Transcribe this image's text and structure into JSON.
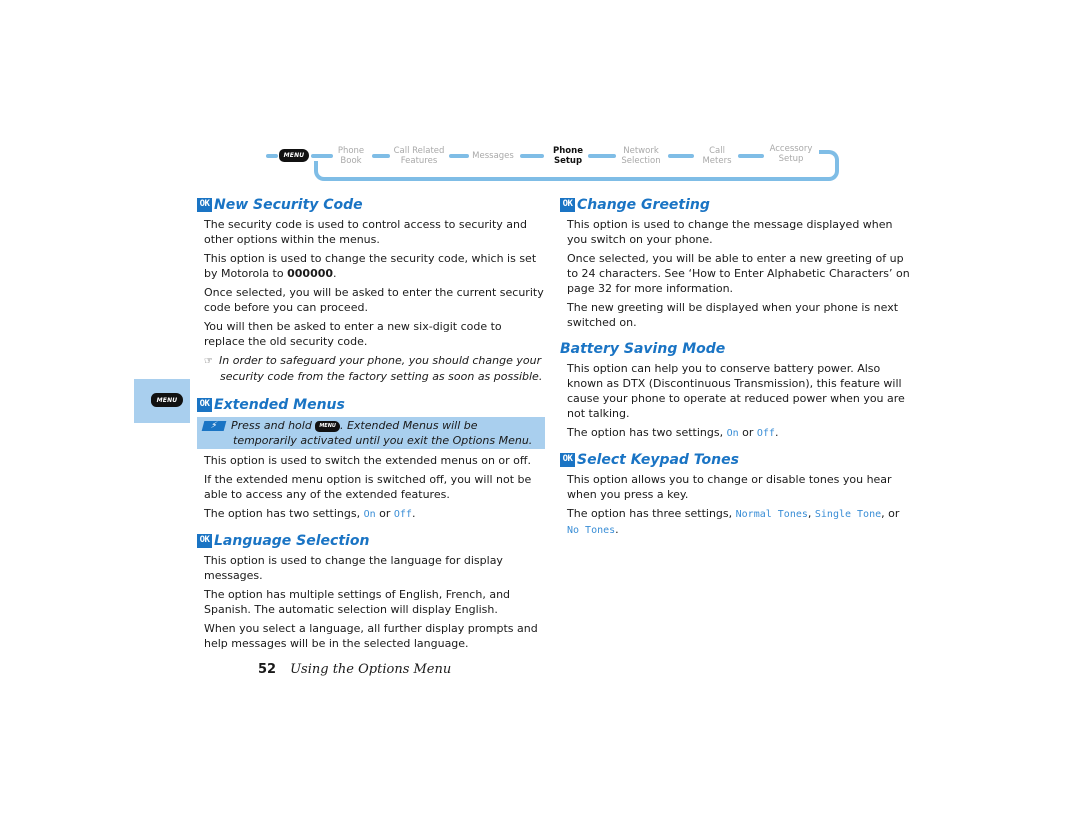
{
  "nav": {
    "menu_key": "MENU",
    "items": [
      {
        "line1": "Phone",
        "line2": "Book",
        "active": false
      },
      {
        "line1": "Call Related",
        "line2": "Features",
        "active": false
      },
      {
        "line1": "Messages",
        "line2": "",
        "active": false
      },
      {
        "line1": "Phone",
        "line2": "Setup",
        "active": true
      },
      {
        "line1": "Network",
        "line2": "Selection",
        "active": false
      },
      {
        "line1": "Call",
        "line2": "Meters",
        "active": false
      },
      {
        "line1": "Accessory",
        "line2": "Setup",
        "active": false
      }
    ]
  },
  "side_tab": {
    "icon": "menu-key-icon",
    "label": "MENU"
  },
  "ok_label": "OK",
  "left": {
    "new_security_code": {
      "title": "New Security Code",
      "p1": "The security code is used to control access to security and other options within the menus.",
      "p2_pre": "This option is used to change the security code, which is set by Motorola to ",
      "p2_bold": "000000",
      "p2_post": ".",
      "p3": "Once selected, you will be asked to enter the current security code before you can proceed.",
      "p4": "You will then be asked to enter a new six-digit code to replace the old security code.",
      "note_icon": "☞",
      "note": "In order to safeguard your phone, you should change your security code from the factory setting as soon as possible."
    },
    "extended_menus": {
      "title": "Extended Menus",
      "callout_icon": "shortcut-icon",
      "callout_pre": "Press and hold ",
      "callout_key": "MENU",
      "callout_post": ". Extended Menus will be temporarily activated until you exit the Options Menu.",
      "p1": "This option is used to switch the extended menus on or off.",
      "p2": "If the extended menu option is switched off, you will not be able to access any of the extended features.",
      "p3_pre": "The option has two settings, ",
      "opt1": "On",
      "p3_mid": " or ",
      "opt2": "Off",
      "p3_post": "."
    },
    "language_selection": {
      "title": "Language Selection",
      "p1": "This option is used to change the language for display messages.",
      "p2": "The option has multiple settings of English, French, and Spanish. The automatic selection will display English.",
      "p3": "When you select a language, all further display prompts and help messages will be in the selected language."
    }
  },
  "right": {
    "change_greeting": {
      "title": "Change Greeting",
      "p1": "This option is used to change the message displayed when you switch on your phone.",
      "p2": "Once selected, you will be able to enter a new greeting of up to 24 characters. See ‘How to Enter Alphabetic Characters’ on page 32 for more information.",
      "p3": "The new greeting will be displayed when your phone is next switched on."
    },
    "battery_saving": {
      "title": "Battery Saving Mode",
      "p1": "This option can help you to conserve battery power. Also known as DTX (Discontinuous Transmission), this feature will cause your phone to operate at reduced power when you are not talking.",
      "p2_pre": "The option has two settings, ",
      "opt1": "On",
      "p2_mid": " or ",
      "opt2": "Off",
      "p2_post": "."
    },
    "keypad_tones": {
      "title": "Select Keypad Tones",
      "p1": "This option allows you to change or disable tones you hear when you press a key.",
      "p2_pre": "The option has three settings, ",
      "opt1": "Normal Tones",
      "sep1": ", ",
      "opt2": "Single Tone",
      "sep2": ", or ",
      "opt3": "No Tones",
      "p2_post": "."
    }
  },
  "footer": {
    "page_number": "52",
    "chapter": "Using the Options Menu"
  },
  "colors": {
    "accent": "#1a74c4",
    "nav_track": "#7fbde6",
    "callout_bg": "#a9cfee",
    "option_text": "#3a8ed6"
  }
}
